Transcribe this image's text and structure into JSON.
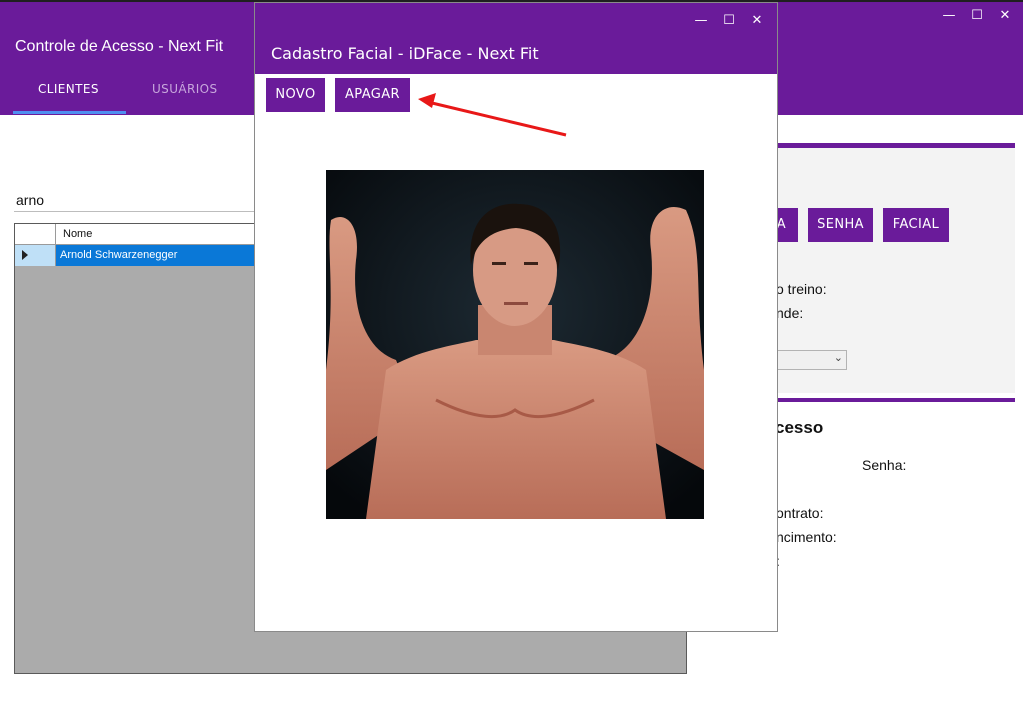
{
  "main_window": {
    "title": "Controle de Acesso - Next Fit",
    "controls": {
      "minimize": "—",
      "maximize": "☐",
      "close": "✕"
    },
    "tabs": [
      {
        "label": "CLIENTES",
        "active": true
      },
      {
        "label": "USUÁRIOS",
        "active": false
      }
    ],
    "search": {
      "value": "arno"
    },
    "grid": {
      "columns": [
        "Nome"
      ],
      "rows": [
        {
          "nome": "Arnold Schwarzenegger",
          "selected": true
        }
      ]
    },
    "right_panel": {
      "buttons": [
        "A",
        "SENHA",
        "FACIAL"
      ],
      "labels": [
        "o treino:",
        "nde:"
      ],
      "section_title": "cesso",
      "fields": [
        "Senha:",
        "ontrato:",
        "ncimento:",
        ":"
      ]
    }
  },
  "dialog": {
    "title": "Cadastro Facial - iDFace - Next Fit",
    "controls": {
      "minimize": "—",
      "maximize": "☐",
      "close": "✕"
    },
    "buttons": {
      "novo": "NOVO",
      "apagar": "APAGAR"
    },
    "photo_icon": "person-photo"
  },
  "colors": {
    "header": "#6a1b9a",
    "selection": "#0a78d7",
    "tab_underline": "#4f8ff0",
    "annotation_arrow": "#e81818"
  }
}
